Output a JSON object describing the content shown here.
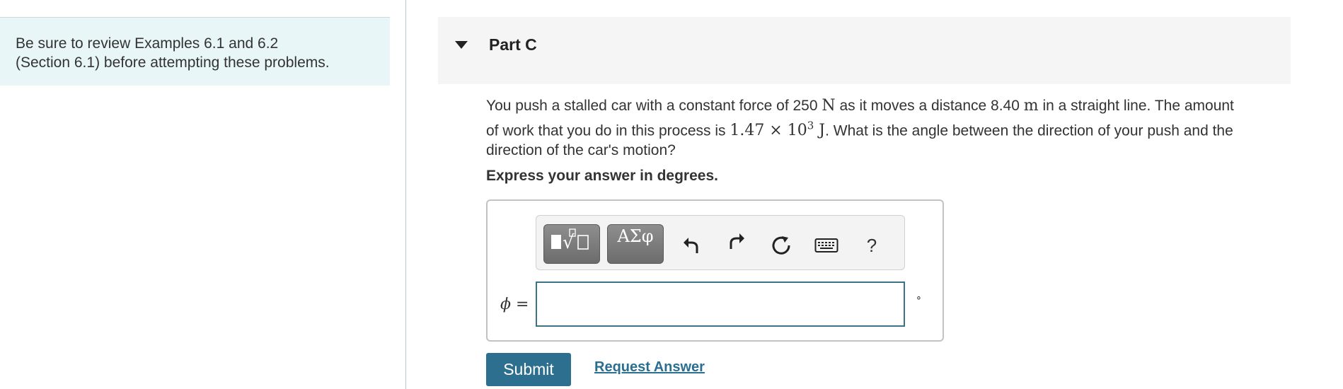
{
  "sidebar": {
    "tip_line1": "Be sure to review Examples 6.1 and 6.2",
    "tip_line2": "(Section 6.1) before attempting these problems."
  },
  "part": {
    "title": "Part C"
  },
  "question": {
    "seg1": "You push a stalled car with a constant force of 250 ",
    "unit_force": "N",
    "seg2": " as it moves a distance 8.40 ",
    "unit_distance": "m",
    "seg3": " in a straight line. The amount",
    "seg4": "of work that you do in this process is ",
    "work_mantissa": "1.47 × 10",
    "work_exponent": "3",
    "work_unit": " J",
    "seg5": ". What is the angle between the direction of your push and the",
    "seg6": "direction of the car's motion?"
  },
  "prompt": "Express your answer in degrees.",
  "answer": {
    "toolbar": {
      "template_icon": "square-root-template-icon",
      "greek_label": "ΑΣφ",
      "undo_icon": "undo-icon",
      "redo_icon": "redo-icon",
      "reset_icon": "reset-icon",
      "keyboard_icon": "keyboard-icon",
      "help_label": "?"
    },
    "variable_symbol": "ϕ",
    "equals": " =",
    "input_value": "",
    "unit_symbol": "∘"
  },
  "actions": {
    "submit_label": "Submit",
    "request_label": "Request Answer"
  }
}
